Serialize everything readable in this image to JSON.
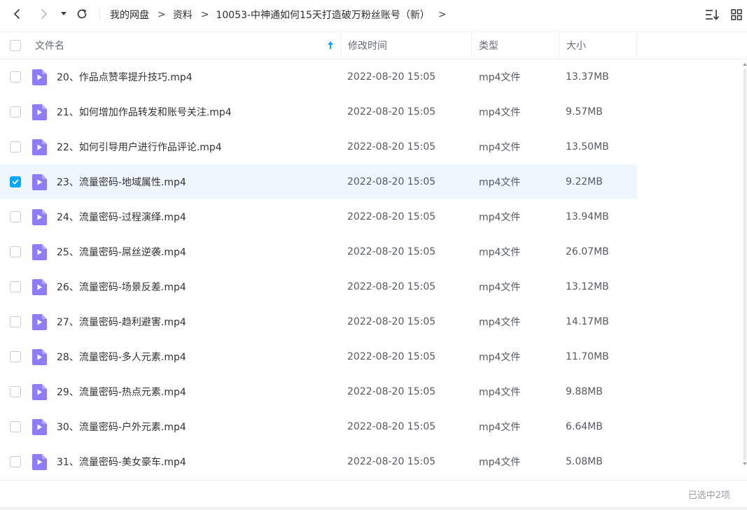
{
  "toolbar": {
    "back_icon": "chevron-left-icon",
    "forward_icon": "chevron-right-icon",
    "history_icon": "caret-down-icon",
    "refresh_icon": "refresh-icon",
    "breadcrumb": [
      "我的网盘",
      "资料",
      "10053-中神通如何15天打造破万粉丝账号（新）"
    ],
    "separator": ">",
    "sort_icon": "sort-list-icon",
    "view_icon": "grid-view-icon"
  },
  "header": {
    "name": "文件名",
    "time": "修改时间",
    "type": "类型",
    "size": "大小",
    "sort_icon": "sort-ascending-arrow-icon"
  },
  "rows": [
    {
      "name": "20、作品点赞率提升技巧.mp4",
      "time": "2022-08-20 15:05",
      "type": "mp4文件",
      "size": "13.37MB",
      "selected": false
    },
    {
      "name": "21、如何增加作品转发和账号关注.mp4",
      "time": "2022-08-20 15:05",
      "type": "mp4文件",
      "size": "9.57MB",
      "selected": false
    },
    {
      "name": "22、如何引导用户进行作品评论.mp4",
      "time": "2022-08-20 15:05",
      "type": "mp4文件",
      "size": "13.50MB",
      "selected": false
    },
    {
      "name": "23、流量密码-地域属性.mp4",
      "time": "2022-08-20 15:05",
      "type": "mp4文件",
      "size": "9.22MB",
      "selected": true
    },
    {
      "name": "24、流量密码-过程演绎.mp4",
      "time": "2022-08-20 15:05",
      "type": "mp4文件",
      "size": "13.94MB",
      "selected": false
    },
    {
      "name": "25、流量密码-屌丝逆袭.mp4",
      "time": "2022-08-20 15:05",
      "type": "mp4文件",
      "size": "26.07MB",
      "selected": false
    },
    {
      "name": "26、流量密码-场景反差.mp4",
      "time": "2022-08-20 15:05",
      "type": "mp4文件",
      "size": "13.12MB",
      "selected": false
    },
    {
      "name": "27、流量密码-趋利避害.mp4",
      "time": "2022-08-20 15:05",
      "type": "mp4文件",
      "size": "14.17MB",
      "selected": false
    },
    {
      "name": "28、流量密码-多人元素.mp4",
      "time": "2022-08-20 15:05",
      "type": "mp4文件",
      "size": "11.70MB",
      "selected": false
    },
    {
      "name": "29、流量密码-热点元素.mp4",
      "time": "2022-08-20 15:05",
      "type": "mp4文件",
      "size": "9.88MB",
      "selected": false
    },
    {
      "name": "30、流量密码-户外元素.mp4",
      "time": "2022-08-20 15:05",
      "type": "mp4文件",
      "size": "6.64MB",
      "selected": false
    },
    {
      "name": "31、流量密码-美女豪车.mp4",
      "time": "2022-08-20 15:05",
      "type": "mp4文件",
      "size": "5.08MB",
      "selected": false
    }
  ],
  "file_icon": "video-file-icon",
  "footer": {
    "status": "已选中2项"
  },
  "colors": {
    "accent": "#06a7ff",
    "selected_row": "#eef7fe",
    "file_icon": "#8e7cf5"
  }
}
